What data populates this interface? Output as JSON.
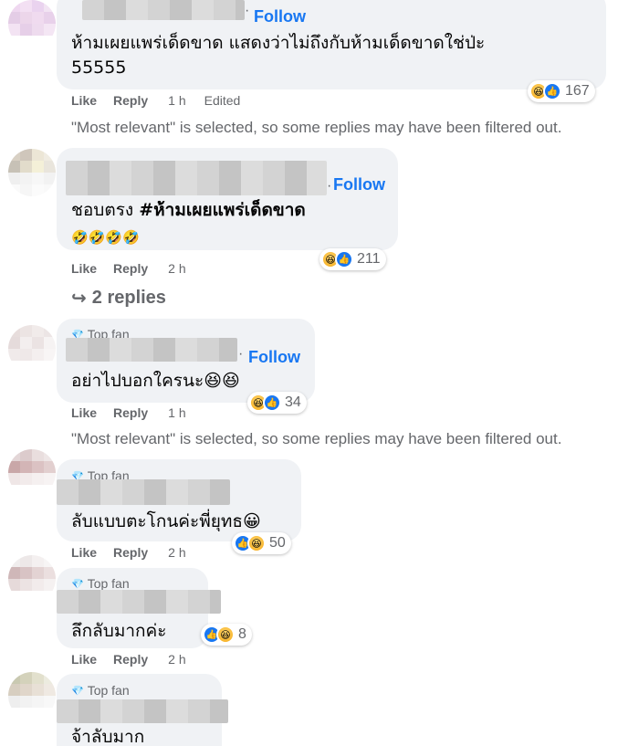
{
  "comments": [
    {
      "follow": "Follow",
      "text": "ห้ามเผยแพร่เด็ดขาด แสดงว่าไม่ถึงกับห้ามเด็ดขาดใช่ป่ะ",
      "text2": "55555",
      "like": "Like",
      "reply": "Reply",
      "time": "1 h",
      "edited": "Edited",
      "reaction_count": "167"
    },
    {
      "follow": "Follow",
      "text_plain": "ชอบตรง ",
      "text_bold": "#ห้ามเผยแพร่เด็ดขาด",
      "emojis": "🤣🤣🤣🤣",
      "like": "Like",
      "reply": "Reply",
      "time": "2 h",
      "reaction_count": "211",
      "replies_label": "2 replies"
    },
    {
      "badge": "Top fan",
      "follow": "Follow",
      "text": "อย่าไปบอกใครนะ😆😆",
      "like": "Like",
      "reply": "Reply",
      "time": "1 h",
      "reaction_count": "34"
    },
    {
      "badge": "Top fan",
      "text": "ลับแบบตะโกนค่ะพี่ยุทธ😀",
      "like": "Like",
      "reply": "Reply",
      "time": "2 h",
      "reaction_count": "50"
    },
    {
      "badge": "Top fan",
      "text": "ลึกลับมากค่ะ",
      "like": "Like",
      "reply": "Reply",
      "time": "2 h",
      "reaction_count": "8"
    },
    {
      "badge": "Top fan",
      "text": "จ้าลับมาก"
    }
  ],
  "filtered_notice": "\"Most relevant\" is selected, so some replies may have been filtered out.",
  "icons": {
    "haha": "haha-reaction-icon",
    "like": "like-reaction-icon",
    "gem": "top-fan-badge-icon",
    "reply_arrow": "reply-arrow-icon"
  },
  "colors": {
    "link_blue": "#1877f2",
    "bubble_bg": "#f0f2f5",
    "meta_gray": "#65676b"
  }
}
